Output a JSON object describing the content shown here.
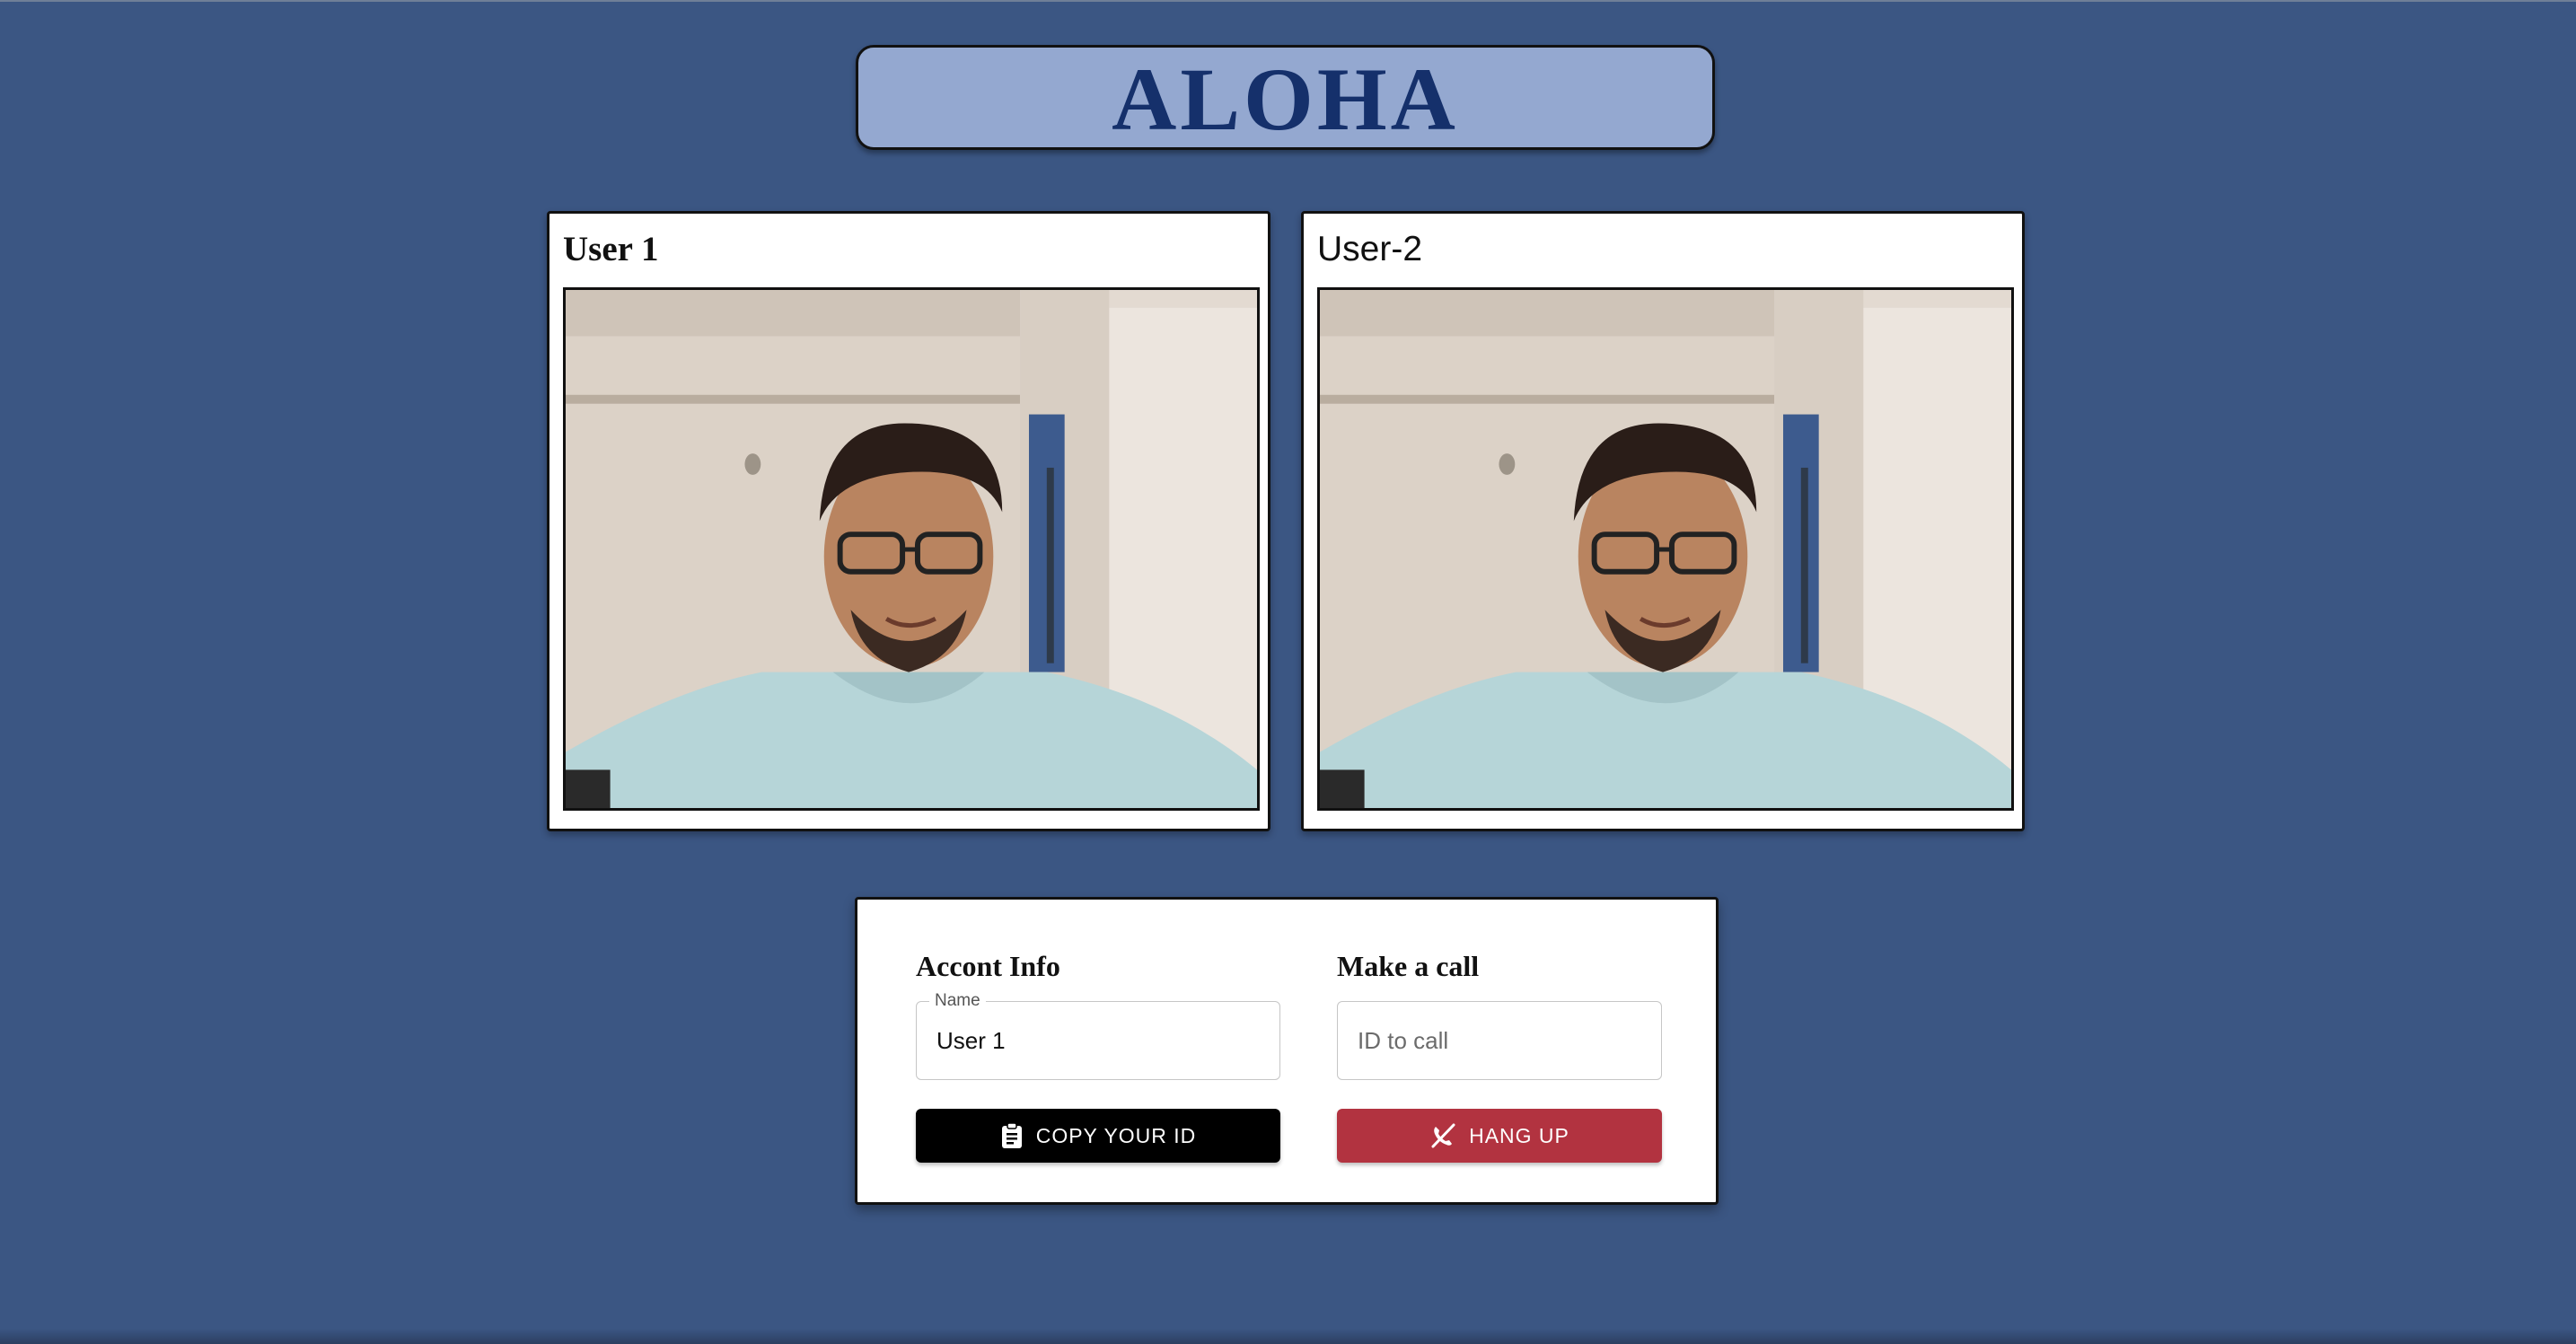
{
  "app": {
    "title": "ALOHA"
  },
  "videos": [
    {
      "label": "User 1"
    },
    {
      "label": "User-2"
    }
  ],
  "account": {
    "heading": "Accont Info",
    "name_label": "Name",
    "name_value": "User 1",
    "copy_button_label": "COPY YOUR ID",
    "copy_icon": "clipboard-icon"
  },
  "call": {
    "heading": "Make a call",
    "id_placeholder": "ID to call",
    "id_value": "",
    "hangup_button_label": "HANG UP",
    "hangup_icon": "phone-disabled-icon"
  },
  "colors": {
    "background": "#3b5683",
    "title_box": "#94a8d0",
    "title_text": "#15306b",
    "hangup": "#b23340",
    "copy": "#000000"
  }
}
